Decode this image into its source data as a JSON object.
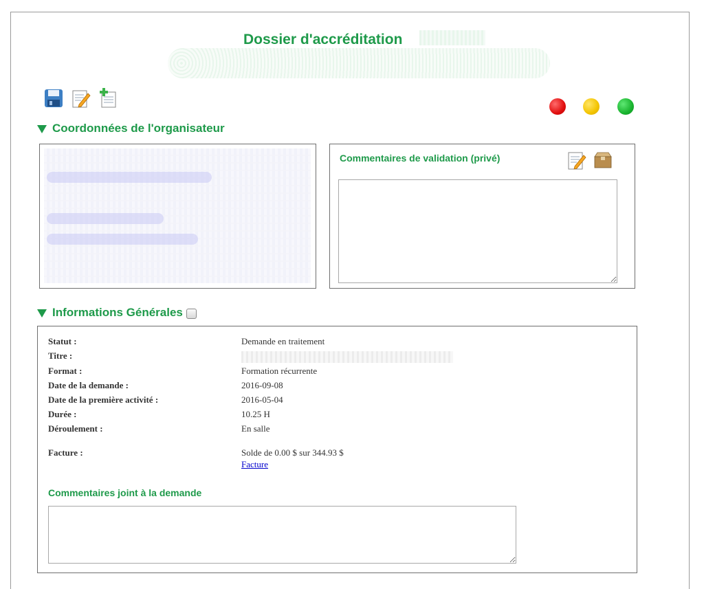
{
  "page": {
    "title": "Dossier d'accréditation"
  },
  "toolbar": {
    "icons": [
      "save-icon",
      "edit-icon",
      "new-document-icon"
    ]
  },
  "status_lights": {
    "colors": [
      "#e10f0f",
      "#f3c400",
      "#1ab42f"
    ]
  },
  "sections": {
    "organizer": {
      "heading": "Coordonnées de l'organisateur"
    },
    "validation_comments": {
      "label": "Commentaires de validation (privé)",
      "value": ""
    },
    "general": {
      "heading": "Informations Générales",
      "fields": [
        {
          "key": "Statut :",
          "value": "Demande en traitement"
        },
        {
          "key": "Titre :",
          "value": ""
        },
        {
          "key": "Format :",
          "value": "Formation récurrente"
        },
        {
          "key": "Date de la demande :",
          "value": "2016-09-08"
        },
        {
          "key": "Date de la première activité :",
          "value": "2016-05-04"
        },
        {
          "key": "Durée :",
          "value": "10.25 H"
        },
        {
          "key": "Déroulement :",
          "value": "En salle"
        }
      ],
      "invoice": {
        "key": "Facture :",
        "value": "Solde de 0.00 $ sur 344.93 $",
        "link": "Facture"
      },
      "joint_comments": {
        "label": "Commentaires joint à la demande",
        "value": ""
      }
    }
  },
  "colors": {
    "accent": "#1e9a4a",
    "link": "#0000cc"
  }
}
